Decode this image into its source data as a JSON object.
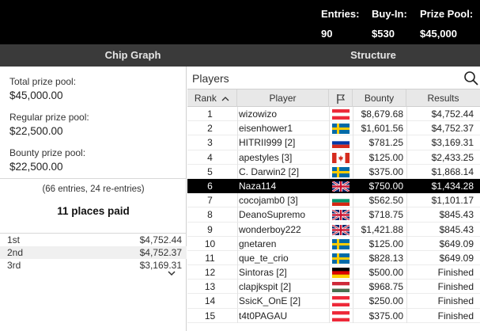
{
  "header": {
    "entries_label": "Entries:",
    "entries_value": "90",
    "buyin_label": "Buy-In:",
    "buyin_value": "$530",
    "prize_label": "Prize Pool:",
    "prize_value": "$45,000"
  },
  "tabs": {
    "chip_graph": "Chip Graph",
    "structure": "Structure"
  },
  "left": {
    "total_label": "Total prize pool:",
    "total_value": "$45,000.00",
    "regular_label": "Regular prize pool:",
    "regular_value": "$22,500.00",
    "bounty_label": "Bounty prize pool:",
    "bounty_value": "$22,500.00",
    "entries_note": "(66 entries, 24 re-entries)",
    "places_paid": "11 places paid",
    "payouts": [
      {
        "place": "1st",
        "amount": "$4,752.44"
      },
      {
        "place": "2nd",
        "amount": "$4,752.37"
      },
      {
        "place": "3rd",
        "amount": "$3,169.31"
      }
    ]
  },
  "players": {
    "title": "Players",
    "columns": {
      "rank": "Rank",
      "player": "Player",
      "bounty": "Bounty",
      "results": "Results"
    },
    "selected_rank": "6",
    "rows": [
      {
        "rank": "1",
        "player": "wizowizo",
        "flag": "austria",
        "bounty": "$8,679.68",
        "results": "$4,752.44"
      },
      {
        "rank": "2",
        "player": "eisenhower1",
        "flag": "sweden",
        "bounty": "$1,601.56",
        "results": "$4,752.37"
      },
      {
        "rank": "3",
        "player": "HITRII999 [2]",
        "flag": "russia",
        "bounty": "$781.25",
        "results": "$3,169.31"
      },
      {
        "rank": "4",
        "player": "apestyles [3]",
        "flag": "canada",
        "bounty": "$125.00",
        "results": "$2,433.25"
      },
      {
        "rank": "5",
        "player": "C. Darwin2 [2]",
        "flag": "sweden",
        "bounty": "$375.00",
        "results": "$1,868.14"
      },
      {
        "rank": "6",
        "player": "Naza114",
        "flag": "uk",
        "bounty": "$750.00",
        "results": "$1,434.28"
      },
      {
        "rank": "7",
        "player": "cocojamb0 [3]",
        "flag": "bulgaria",
        "bounty": "$562.50",
        "results": "$1,101.17"
      },
      {
        "rank": "8",
        "player": "DeanoSupremo",
        "flag": "uk",
        "bounty": "$718.75",
        "results": "$845.43"
      },
      {
        "rank": "9",
        "player": "wonderboy222",
        "flag": "uk",
        "bounty": "$1,421.88",
        "results": "$845.43"
      },
      {
        "rank": "10",
        "player": "gnetaren",
        "flag": "sweden",
        "bounty": "$125.00",
        "results": "$649.09"
      },
      {
        "rank": "11",
        "player": "que_te_crio",
        "flag": "sweden",
        "bounty": "$828.13",
        "results": "$649.09"
      },
      {
        "rank": "12",
        "player": "Sintoras [2]",
        "flag": "germany",
        "bounty": "$500.00",
        "results": "Finished"
      },
      {
        "rank": "13",
        "player": "clapjkspit [2]",
        "flag": "hungary",
        "bounty": "$968.75",
        "results": "Finished"
      },
      {
        "rank": "14",
        "player": "SsicK_OnE [2]",
        "flag": "austria",
        "bounty": "$250.00",
        "results": "Finished"
      },
      {
        "rank": "15",
        "player": "t4t0PAGAU",
        "flag": "austria",
        "bounty": "$375.00",
        "results": "Finished"
      }
    ]
  },
  "colors": {
    "header_bg": "#000000",
    "tabs_bg": "#3a3a3a",
    "selected_row_bg": "#000000",
    "column_header_bg": "#e8e8e8"
  }
}
